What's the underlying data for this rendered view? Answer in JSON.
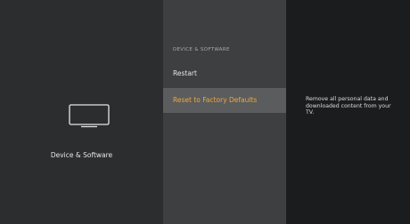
{
  "left_panel": {
    "icon": "tv-icon",
    "label": "Device & Software"
  },
  "middle_panel": {
    "heading": "DEVICE & SOFTWARE",
    "items": [
      {
        "label": "Restart",
        "selected": false
      },
      {
        "label": "Reset to Factory Defaults",
        "selected": true
      }
    ]
  },
  "right_panel": {
    "description": "Remove all personal data and downloaded content from your TV."
  },
  "colors": {
    "highlight_text": "#f0a73a",
    "selected_bg": "#5a5c5d"
  }
}
